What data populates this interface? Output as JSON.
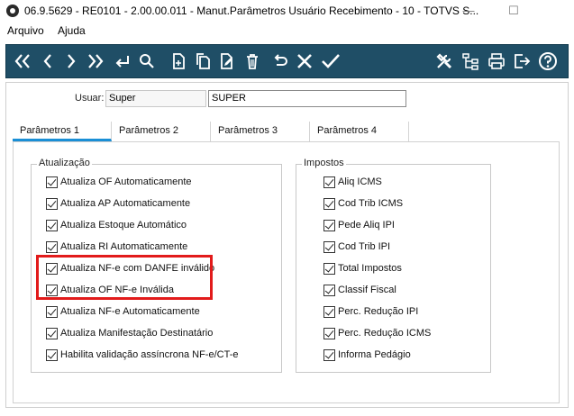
{
  "window": {
    "title": "06.9.5629 - RE0101 - 2.00.00.011 - Manut.Parâmetros Usuário Recebimento - 10 - TOTVS S...",
    "minimize": "—",
    "maximize": "☐"
  },
  "menu": {
    "items": [
      "Arquivo",
      "Ajuda"
    ]
  },
  "toolbar": {
    "icons": [
      "first-record-icon",
      "previous-record-icon",
      "next-record-icon",
      "last-record-icon",
      "goto-icon",
      "search-icon",
      "new-icon",
      "copy-icon",
      "edit-icon",
      "delete-icon",
      "undo-icon",
      "cancel-icon",
      "confirm-icon",
      "tools-icon",
      "hierarchy-icon",
      "print-icon",
      "exit-icon",
      "help-icon"
    ]
  },
  "user": {
    "label": "Usuar:",
    "code": "Super",
    "name": "SUPER"
  },
  "tabs": [
    {
      "label": "Parâmetros 1",
      "active": true
    },
    {
      "label": "Parâmetros 2",
      "active": false
    },
    {
      "label": "Parâmetros 3",
      "active": false
    },
    {
      "label": "Parâmetros 4",
      "active": false
    }
  ],
  "atualizacao": {
    "title": "Atualização",
    "items": [
      {
        "label": "Atualiza OF Automaticamente",
        "checked": true
      },
      {
        "label": "Atualiza AP Automaticamente",
        "checked": true
      },
      {
        "label": "Atualiza Estoque Automático",
        "checked": true
      },
      {
        "label": "Atualiza RI Automaticamente",
        "checked": true
      },
      {
        "label": "Atualiza NF-e com DANFE inválido",
        "checked": true
      },
      {
        "label": "Atualiza OF NF-e Inválida",
        "checked": true
      },
      {
        "label": "Atualiza NF-e Automaticamente",
        "checked": true
      },
      {
        "label": "Atualiza Manifestação Destinatário",
        "checked": true
      },
      {
        "label": "Habilita validação assíncrona NF-e/CT-e",
        "checked": true
      }
    ]
  },
  "impostos": {
    "title": "Impostos",
    "items": [
      {
        "label": "Aliq ICMS",
        "checked": true
      },
      {
        "label": "Cod Trib ICMS",
        "checked": true
      },
      {
        "label": "Pede Aliq IPI",
        "checked": true
      },
      {
        "label": "Cod Trib IPI",
        "checked": true
      },
      {
        "label": "Total Impostos",
        "checked": true
      },
      {
        "label": "Classif Fiscal",
        "checked": true
      },
      {
        "label": "Perc. Redução IPI",
        "checked": true
      },
      {
        "label": "Perc. Redução ICMS",
        "checked": true
      },
      {
        "label": "Informa Pedágio",
        "checked": true
      }
    ]
  },
  "colors": {
    "toolbar_bg": "#1f4e66",
    "tab_accent": "#1a8fd6",
    "highlight": "#e21b1b"
  }
}
